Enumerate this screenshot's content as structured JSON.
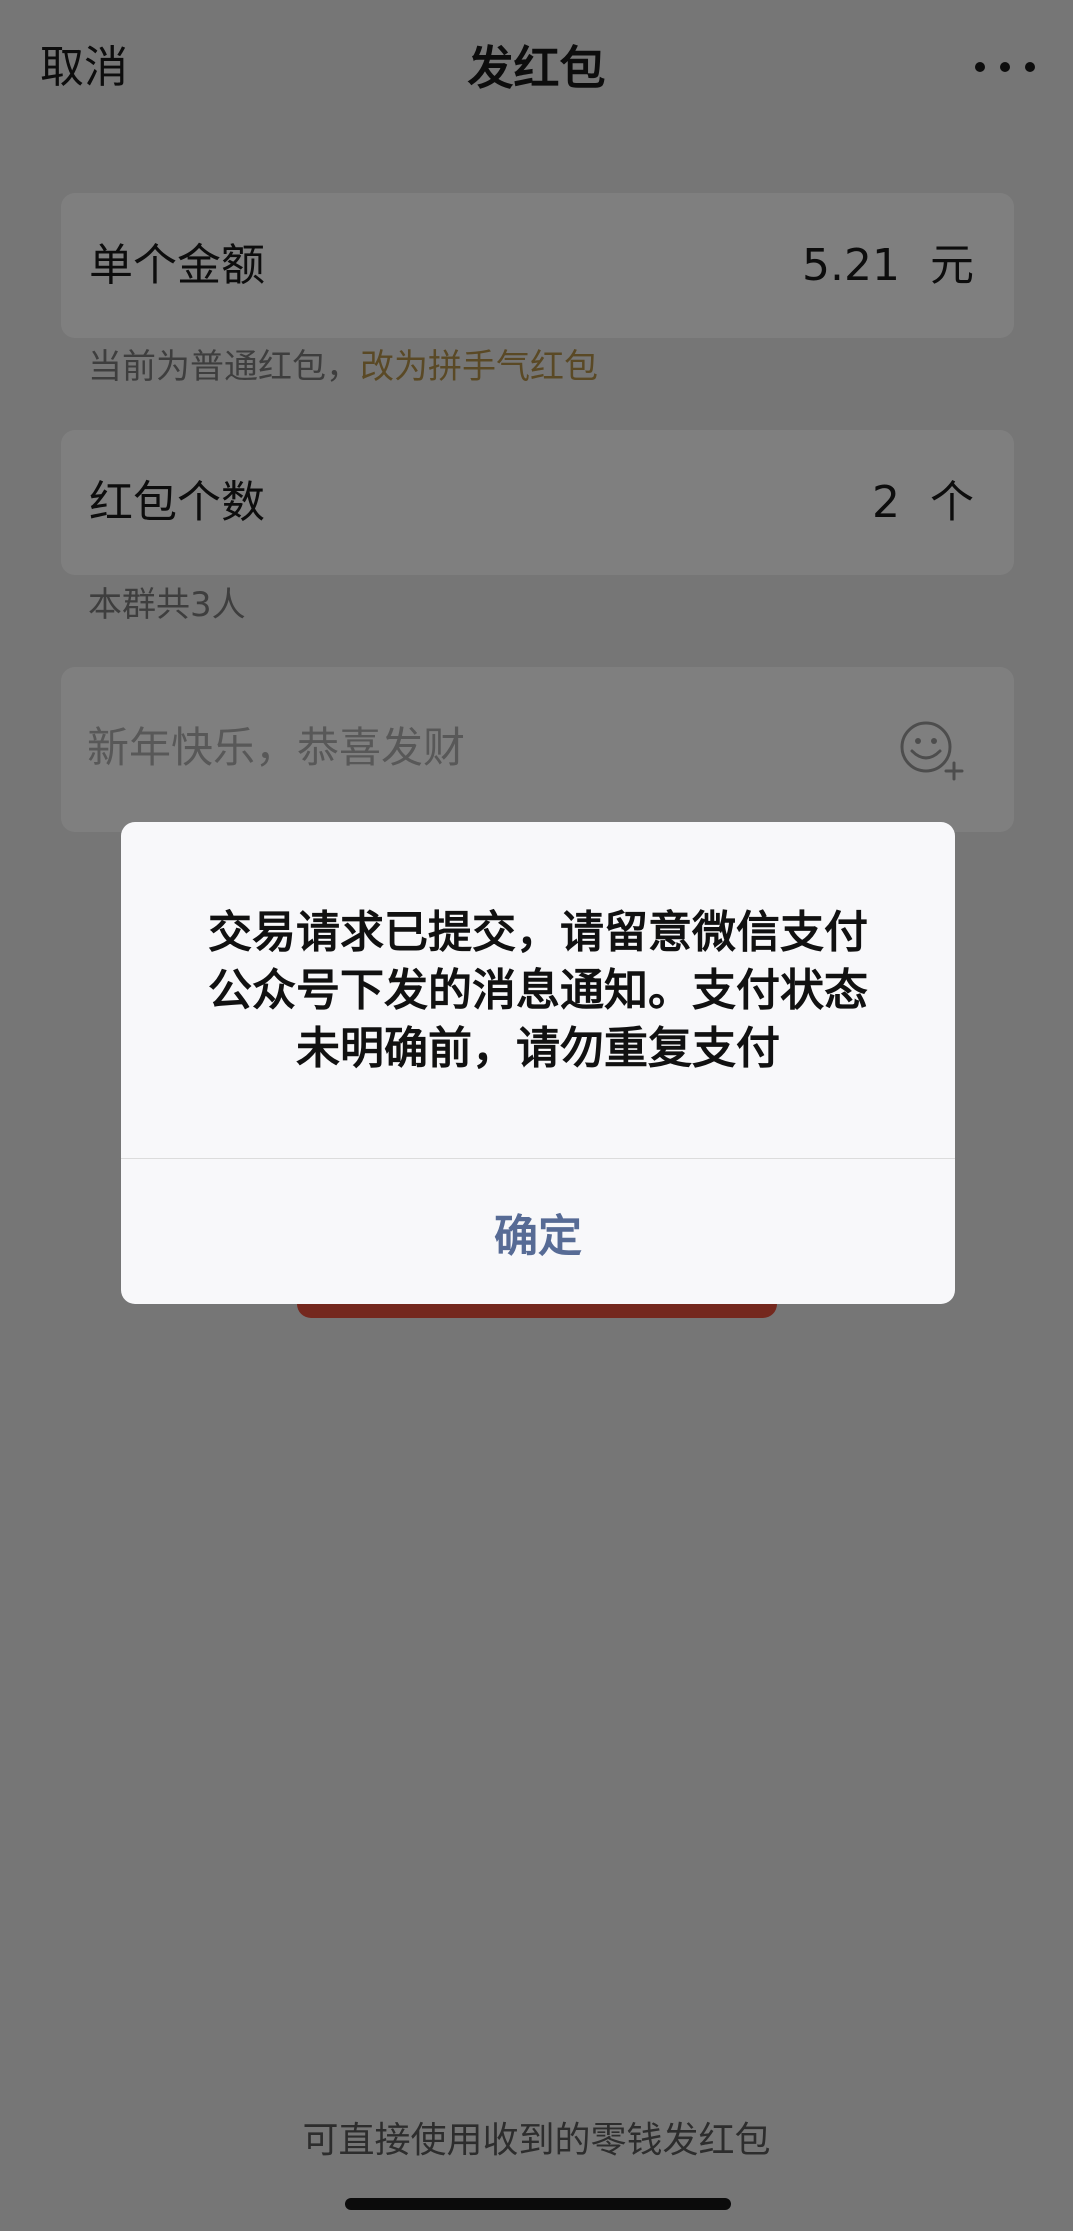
{
  "header": {
    "cancel_label": "取消",
    "title": "发红包",
    "more_icon": "more-icon"
  },
  "amount": {
    "label": "单个金额",
    "value": "5.21",
    "unit": "元",
    "hint_prefix": "当前为普通红包，",
    "hint_link": "改为拼手气红包"
  },
  "count": {
    "label": "红包个数",
    "value": "2",
    "unit": "个",
    "hint": "本群共3人"
  },
  "message": {
    "placeholder": "新年快乐，恭喜发财",
    "emoji_icon": "emoji-add-icon"
  },
  "footer": {
    "note": "可直接使用收到的零钱发红包"
  },
  "dialog": {
    "message": "交易请求已提交，请留意微信支付公众号下发的消息通知。支付状态未明确前，请勿重复支付",
    "confirm_label": "确定"
  },
  "colors": {
    "link": "#b5924a",
    "confirm": "#576b95",
    "pay_button": "#e9503c"
  }
}
